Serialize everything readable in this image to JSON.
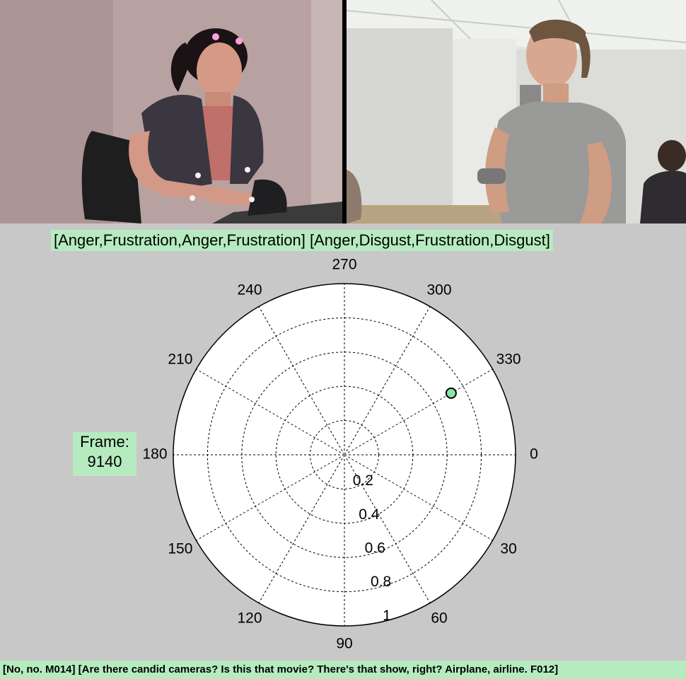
{
  "chart_data": {
    "type": "scatter",
    "projection": "polar",
    "title": "[Anger,Frustration,Anger,Frustration] [Anger,Disgust,Frustration,Disgust]",
    "angle_ticks": [
      "0",
      "30",
      "60",
      "90",
      "120",
      "150",
      "180",
      "210",
      "240",
      "270",
      "300",
      "330"
    ],
    "angle_tick_values": [
      0,
      30,
      60,
      90,
      120,
      150,
      180,
      210,
      240,
      270,
      300,
      330
    ],
    "radius_ticks": [
      "0.2",
      "0.4",
      "0.6",
      "0.8",
      "1"
    ],
    "radius_tick_values": [
      0.2,
      0.4,
      0.6,
      0.8,
      1.0
    ],
    "rlim": [
      0,
      1
    ],
    "grid": true,
    "points": [
      {
        "theta": 330,
        "r": 0.72,
        "color": "#86e6a4"
      }
    ]
  },
  "frame": {
    "label": "Frame:",
    "value": "9140"
  },
  "transcript": "[No, no. M014] [Are there candid cameras?  Is this that movie? There's that show, right?  Airplane, airline. F012]",
  "colors": {
    "highlight": "#b6ebbf",
    "background": "#c8c8c8",
    "plot_bg": "#ffffff",
    "marker": "#86e6a4"
  }
}
